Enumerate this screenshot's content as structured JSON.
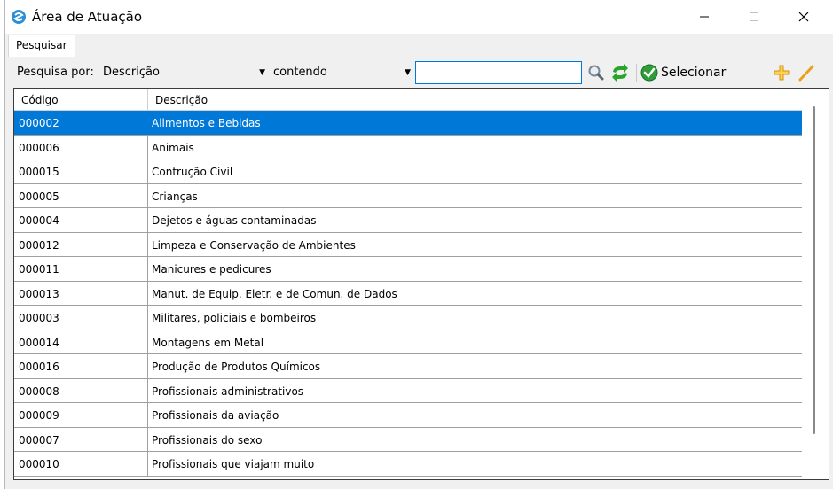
{
  "window": {
    "title": "Área de Atuação"
  },
  "tabs": [
    {
      "label": "Pesquisar"
    }
  ],
  "toolbar": {
    "search_by_label": "Pesquisa por:",
    "field_combo_value": "Descrição",
    "operator_combo_value": "contendo",
    "search_value": "",
    "select_label": "Selecionar"
  },
  "grid": {
    "columns": [
      "Código",
      "Descrição"
    ],
    "selected_index": 0,
    "rows": [
      {
        "code": "000002",
        "desc": "Alimentos e Bebidas"
      },
      {
        "code": "000006",
        "desc": "Animais"
      },
      {
        "code": "000015",
        "desc": "Contrução Civil"
      },
      {
        "code": "000005",
        "desc": "Crianças"
      },
      {
        "code": "000004",
        "desc": "Dejetos e águas contaminadas"
      },
      {
        "code": "000012",
        "desc": "Limpeza e Conservação de Ambientes"
      },
      {
        "code": "000011",
        "desc": "Manicures e pedicures"
      },
      {
        "code": "000013",
        "desc": "Manut. de Equip. Eletr. e de Comun. de Dados"
      },
      {
        "code": "000003",
        "desc": "Militares, policiais e bombeiros"
      },
      {
        "code": "000014",
        "desc": "Montagens em Metal"
      },
      {
        "code": "000016",
        "desc": "Produção de Produtos Químicos"
      },
      {
        "code": "000008",
        "desc": "Profissionais administrativos"
      },
      {
        "code": "000009",
        "desc": "Profissionais da aviação"
      },
      {
        "code": "000007",
        "desc": "Profissionais do sexo"
      },
      {
        "code": "000010",
        "desc": "Profissionais que viajam muito"
      }
    ]
  },
  "colors": {
    "selection": "#0078d7",
    "refresh_icon": "#2aa52a",
    "select_icon": "#2e9d3a",
    "add_icon": "#e8a317",
    "edit_icon": "#e8a317"
  },
  "icons": {
    "app": "app-logo-icon",
    "search": "magnifier-icon",
    "refresh": "refresh-icon",
    "select": "check-circle-icon",
    "add": "plus-icon",
    "edit": "pencil-icon"
  }
}
